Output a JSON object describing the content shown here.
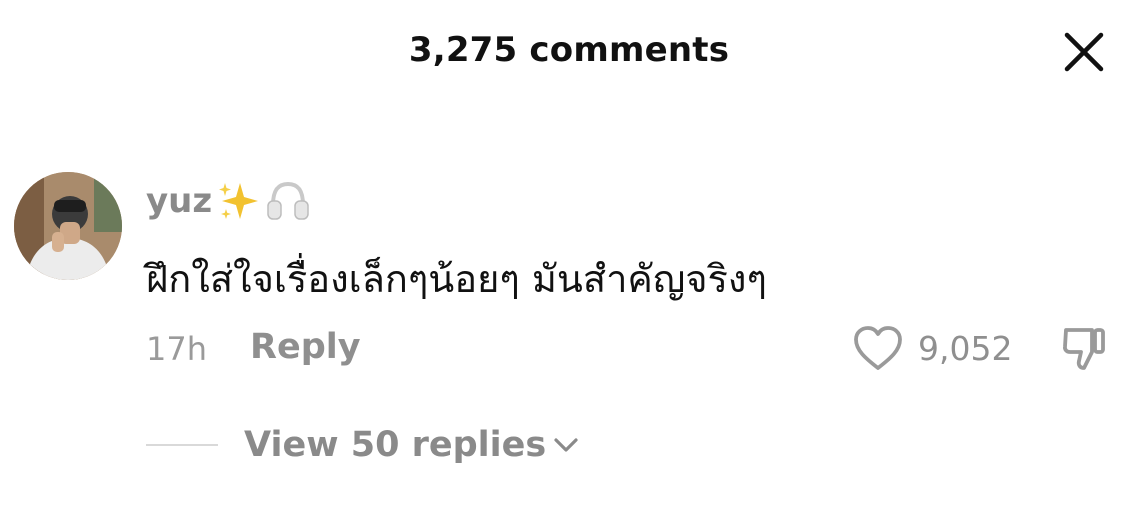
{
  "header": {
    "title": "3,275 comments",
    "close_icon": "close-icon"
  },
  "comment": {
    "avatar_icon": "user-avatar",
    "username": "yuz",
    "username_emojis": [
      "sparkles-icon",
      "headphones-icon"
    ],
    "text": "ฝึกใส่ใจเรื่องเล็กๆน้อยๆ มันสำคัญจริงๆ",
    "time": "17h",
    "reply_label": "Reply",
    "like_count": "9,052",
    "like_icon": "heart-icon",
    "dislike_icon": "thumbs-down-icon",
    "view_replies_label": "View 50 replies",
    "view_replies_icon": "chevron-down-icon"
  },
  "colors": {
    "primary_text": "#111111",
    "secondary_text": "#8a8a8a",
    "sparkle": "#f2c230",
    "background": "#ffffff"
  }
}
